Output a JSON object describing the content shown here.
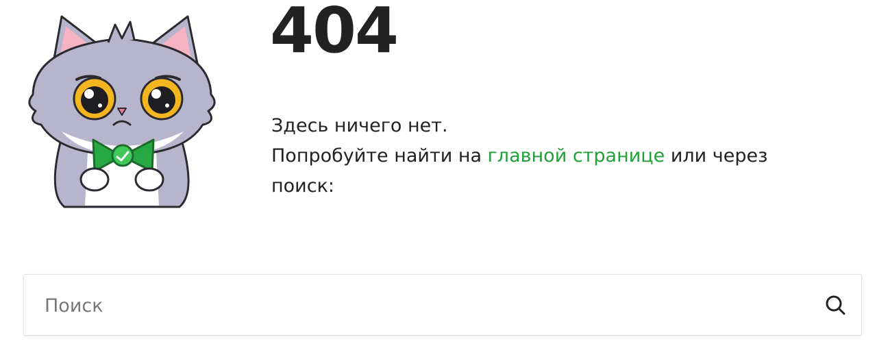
{
  "error": {
    "code": "404"
  },
  "message": {
    "line1": "Здесь ничего нет.",
    "line2_before": "Попробуйте найти на ",
    "line2_link": "главной странице",
    "line2_after": " или через поиск:"
  },
  "search": {
    "placeholder": "Поиск",
    "value": "",
    "icon": "search-icon"
  },
  "mascot": {
    "icon": "sad-cat-mascot"
  },
  "colors": {
    "text": "#222222",
    "link": "#21a038",
    "placeholder": "#777777",
    "border": "#e3e3e3"
  }
}
